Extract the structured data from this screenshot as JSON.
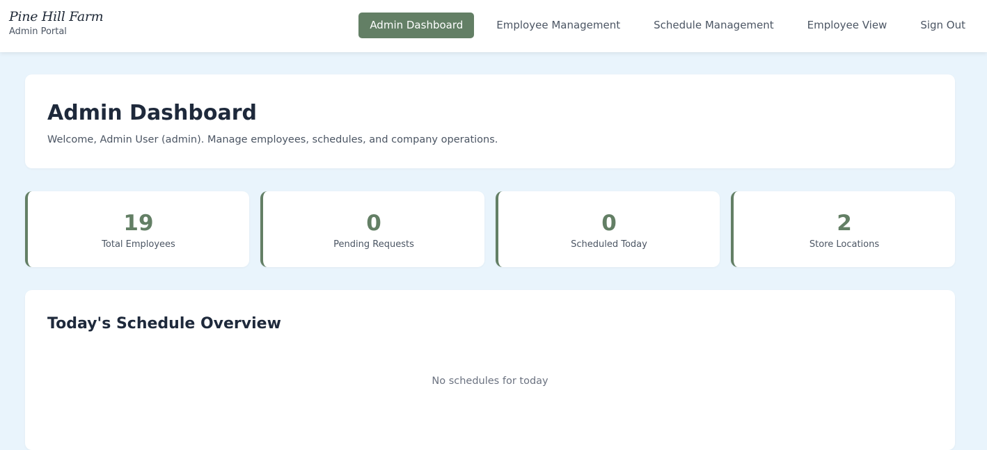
{
  "brand": {
    "name": "Pine Hill Farm",
    "subtitle": "Admin Portal"
  },
  "nav": {
    "items": [
      {
        "label": "Admin Dashboard",
        "active": true
      },
      {
        "label": "Employee Management",
        "active": false
      },
      {
        "label": "Schedule Management",
        "active": false
      },
      {
        "label": "Employee View",
        "active": false
      },
      {
        "label": "Sign Out",
        "active": false
      }
    ]
  },
  "header": {
    "title": "Admin Dashboard",
    "welcome": "Welcome, Admin User (admin). Manage employees, schedules, and company operations."
  },
  "stats": [
    {
      "value": "19",
      "label": "Total Employees"
    },
    {
      "value": "0",
      "label": "Pending Requests"
    },
    {
      "value": "0",
      "label": "Scheduled Today"
    },
    {
      "value": "2",
      "label": "Store Locations"
    }
  ],
  "schedule": {
    "title": "Today's Schedule Overview",
    "empty_message": "No schedules for today"
  },
  "colors": {
    "accent": "#637f65",
    "background": "#e9f4fc",
    "card": "#ffffff",
    "heading": "#1e293b",
    "muted": "#4b5563"
  }
}
